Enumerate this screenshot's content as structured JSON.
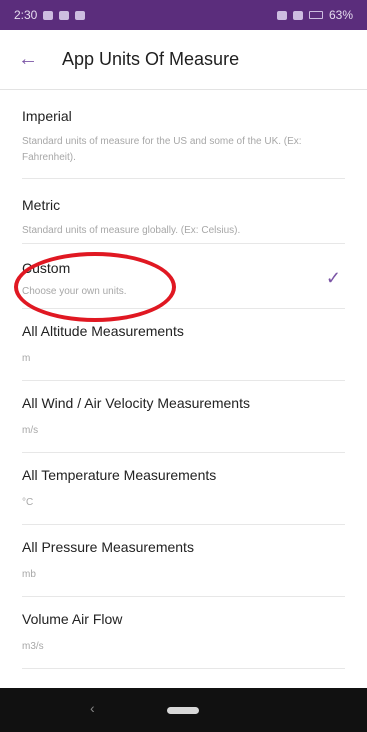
{
  "status_bar": {
    "time": "2:30",
    "battery": "63%"
  },
  "header": {
    "back_icon": "arrow-left-icon",
    "title": "App Units Of Measure"
  },
  "options": [
    {
      "title": "Imperial",
      "description": "Standard units of measure for the US and some of the UK. (Ex: Fahrenheit)."
    },
    {
      "title": "Metric",
      "description": "Standard units of measure globally. (Ex: Celsius)."
    },
    {
      "title": "Custom",
      "description": "Choose your own units.",
      "selected": true
    }
  ],
  "units": [
    {
      "title": "All Altitude Measurements",
      "value": "m"
    },
    {
      "title": "All Wind / Air Velocity Measurements",
      "value": "m/s"
    },
    {
      "title": "All Temperature Measurements",
      "value": "°C"
    },
    {
      "title": "All Pressure Measurements",
      "value": "mb"
    },
    {
      "title": "Volume Air Flow",
      "value": "m3/s"
    }
  ],
  "colors": {
    "status_bar": "#5b2d7c",
    "accent": "#7b55a6",
    "highlight": "#e01822"
  }
}
